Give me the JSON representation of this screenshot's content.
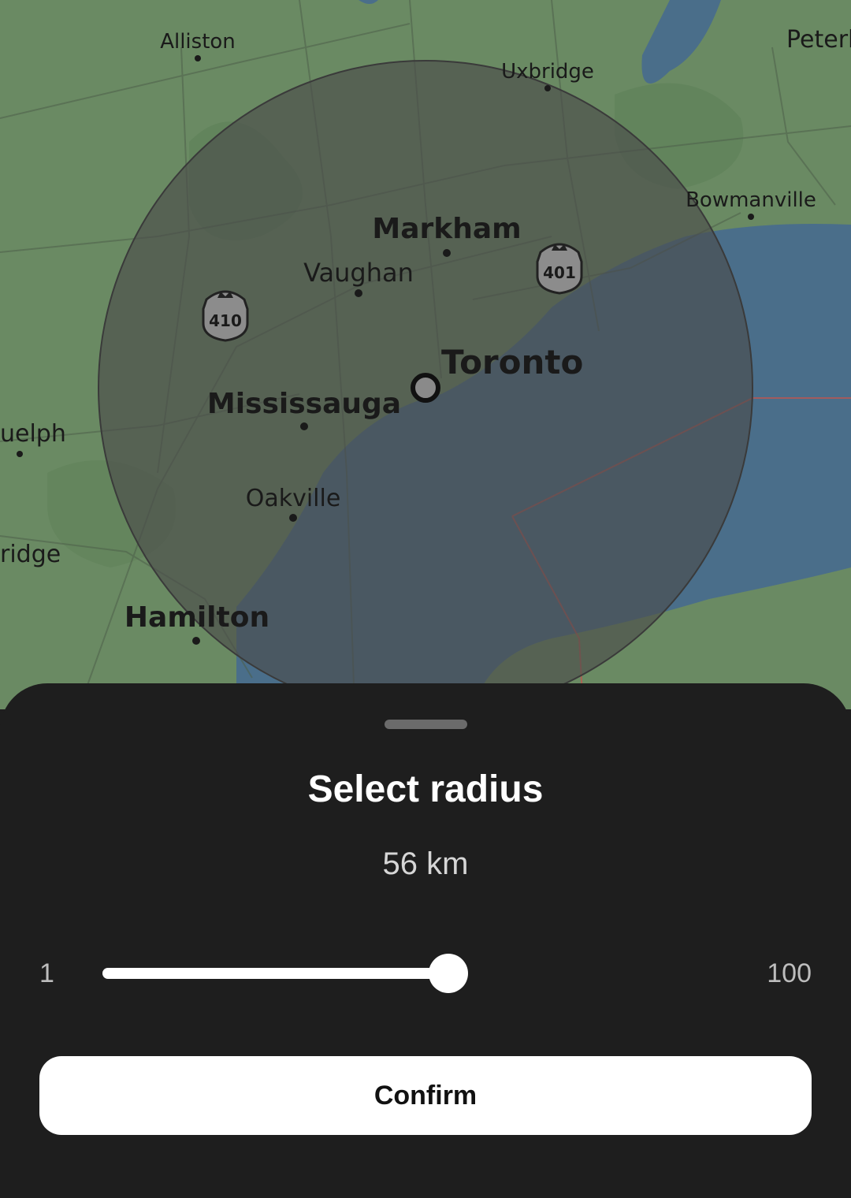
{
  "map": {
    "labels": {
      "alliston": "Alliston",
      "uxbridge": "Uxbridge",
      "peter": "Peterl",
      "bowmanville": "Bowmanville",
      "markham": "Markham",
      "vaughan": "Vaughan",
      "toronto": "Toronto",
      "mississauga": "Mississauga",
      "guelph": "uelph",
      "oakville": "Oakville",
      "ridge": "ridge",
      "hamilton": "Hamilton",
      "route_410": "410",
      "route_401": "401"
    },
    "colors": {
      "land": "#6a8a63",
      "water": "#4a6e8a",
      "radius_overlay": "#4a4a4a"
    },
    "center_marker_icon": "location-ring-icon",
    "highway_shield_icon": "ontario-highway-shield-icon"
  },
  "sheet": {
    "title": "Select radius",
    "value_text": "56 km",
    "slider": {
      "min_label": "1",
      "max_label": "100",
      "min": 1,
      "max": 100,
      "value": 56
    },
    "confirm_label": "Confirm"
  }
}
